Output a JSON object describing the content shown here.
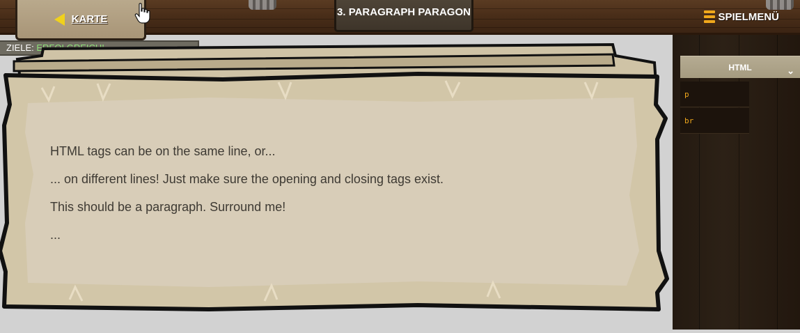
{
  "topbar": {
    "back_label": "KARTE",
    "level_title": "3. PARAGRAPH PARAGON",
    "menu_label": "SPIELMENÜ"
  },
  "goals": {
    "prefix": "ZIELE:",
    "status": "ERFOLGREICH!"
  },
  "lesson": {
    "lines": [
      "HTML tags can be on the same line, or...",
      "... on different lines! Just make sure the opening and closing tags exist.",
      "This should be a paragraph. Surround me!",
      "..."
    ]
  },
  "sidebar": {
    "tab_label": "HTML",
    "snippets": [
      "p",
      "br"
    ]
  },
  "colors": {
    "accent_yellow": "#f0d11c",
    "menu_orange": "#f0a81c",
    "goal_green": "#8fe07a",
    "parchment": "#d8cdb8",
    "parchment_edge": "#c9b892"
  }
}
